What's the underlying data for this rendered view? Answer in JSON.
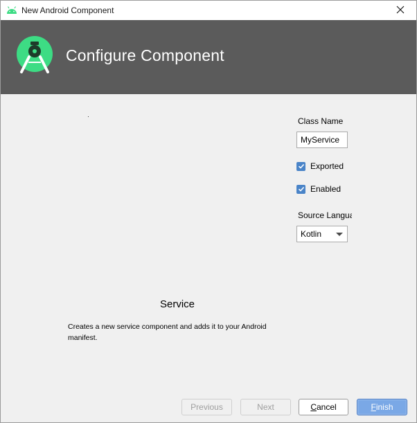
{
  "window": {
    "title": "New Android Component",
    "header_title": "Configure Component"
  },
  "component": {
    "name": "Service",
    "description": "Creates a new service component and adds it to your Android manifest."
  },
  "form": {
    "class_name_label": "Class Name",
    "class_name_value": "MyService",
    "exported_label": "Exported",
    "exported_checked": true,
    "enabled_label": "Enabled",
    "enabled_checked": true,
    "source_language_label": "Source Langua",
    "source_language_value": "Kotlin"
  },
  "buttons": {
    "previous": "Previous",
    "next": "Next",
    "cancel_first": "C",
    "cancel_rest": "ancel",
    "finish_first": "F",
    "finish_rest": "inish"
  },
  "colors": {
    "header_bg": "#5b5b5b",
    "android_green": "#3ddc84",
    "accent_blue": "#4a84c8"
  },
  "icons": {
    "app": "android-head-icon",
    "close": "close-icon",
    "logo": "android-studio-logo",
    "check": "checkmark-icon",
    "dropdown": "chevron-down-icon"
  }
}
